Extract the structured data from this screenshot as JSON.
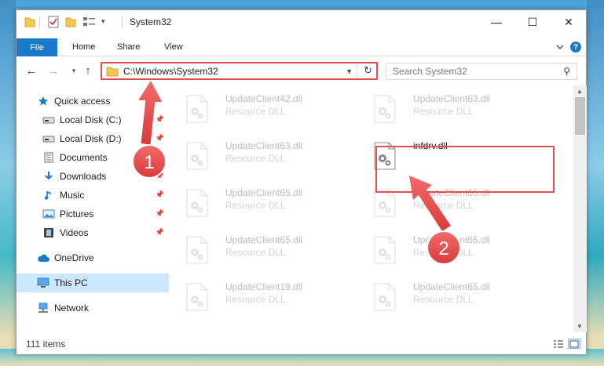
{
  "window": {
    "title": "System32"
  },
  "ribbon": {
    "tabs": [
      "File",
      "Home",
      "Share",
      "View"
    ]
  },
  "window_controls": {
    "minimize": "—",
    "maximize": "☐",
    "close": "✕"
  },
  "address": {
    "path": "C:\\Windows\\System32"
  },
  "search": {
    "placeholder": "Search System32"
  },
  "sidebar": {
    "items": [
      {
        "label": "Quick access",
        "icon": "star-icon",
        "pinned": false
      },
      {
        "label": "Local Disk (C:)",
        "icon": "drive-icon",
        "pinned": true
      },
      {
        "label": "Local Disk (D:)",
        "icon": "drive-icon",
        "pinned": true
      },
      {
        "label": "Documents",
        "icon": "documents-icon",
        "pinned": true
      },
      {
        "label": "Downloads",
        "icon": "downloads-icon",
        "pinned": true
      },
      {
        "label": "Music",
        "icon": "music-icon",
        "pinned": true
      },
      {
        "label": "Pictures",
        "icon": "pictures-icon",
        "pinned": true
      },
      {
        "label": "Videos",
        "icon": "videos-icon",
        "pinned": true
      },
      {
        "label": "OneDrive",
        "icon": "cloud-icon",
        "pinned": false
      },
      {
        "label": "This PC",
        "icon": "monitor-icon",
        "pinned": false,
        "selected": true
      },
      {
        "label": "Network",
        "icon": "network-icon",
        "pinned": false
      }
    ]
  },
  "files": [
    {
      "name": "UpdateClient42.dll",
      "type": "Resource DLL"
    },
    {
      "name": "UpdateClient63.dll",
      "type": "Resource DLL"
    },
    {
      "name": "UpdateClient63.dll",
      "type": "Resource DLL"
    },
    {
      "name": "infdrv.dll",
      "type": "",
      "focused": true
    },
    {
      "name": "UpdateClient65.dll",
      "type": "Resource DLL"
    },
    {
      "name": "UpdateClient65.dll",
      "type": "Resource DLL"
    },
    {
      "name": "UpdateClient65.dll",
      "type": "Resource DLL"
    },
    {
      "name": "UpdateClient65.dll",
      "type": "Resource DLL"
    },
    {
      "name": "UpdateClient19.dll",
      "type": "Resource DLL"
    },
    {
      "name": "UpdateClient65.dll",
      "type": "Resource DLL"
    }
  ],
  "status": {
    "item_count": "111 items"
  },
  "annotations": {
    "step1": "1",
    "step2": "2"
  },
  "colors": {
    "accent": "#1979ca",
    "highlight": "#e34e4e",
    "selected": "#cce8ff"
  }
}
